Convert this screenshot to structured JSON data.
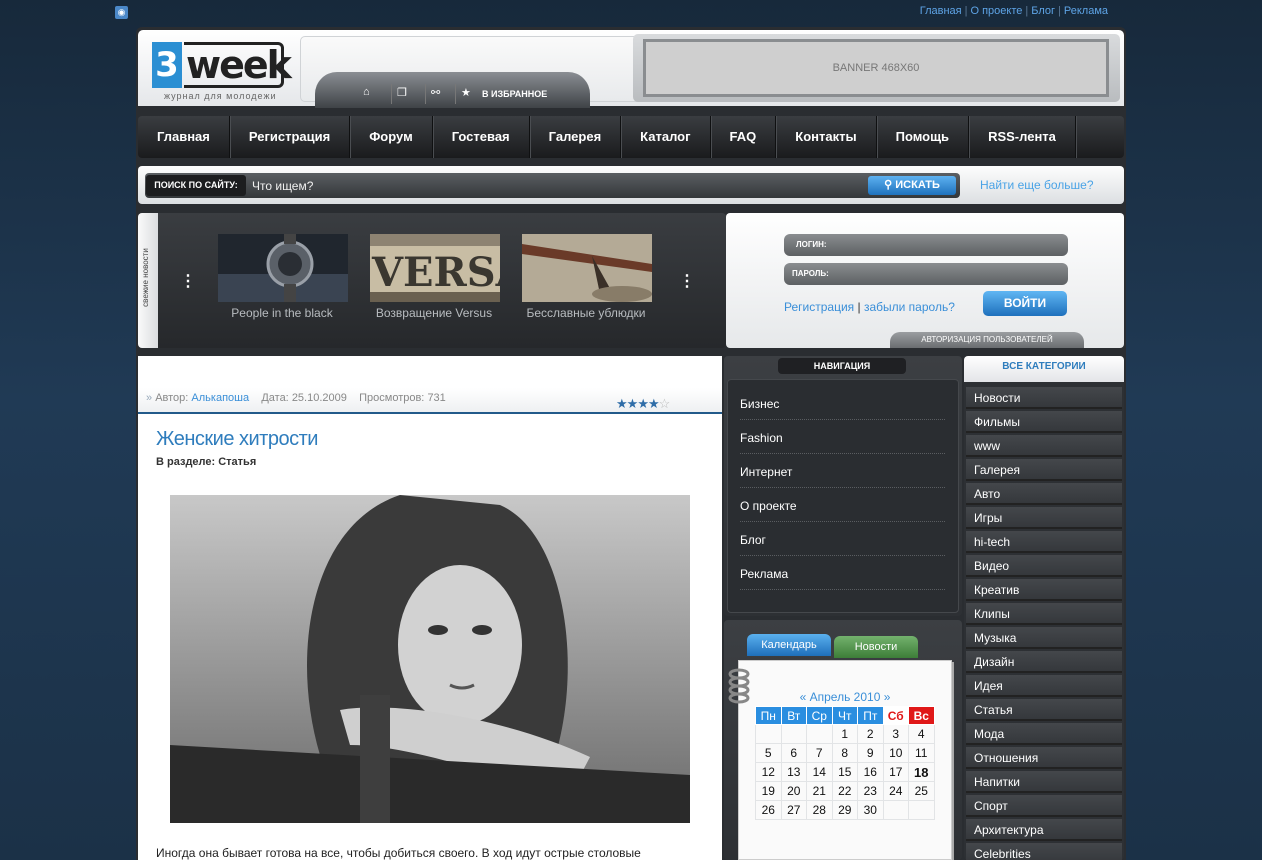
{
  "toplinks": [
    "Главная",
    "О проекте",
    "Блог",
    "Реклама"
  ],
  "logo": {
    "num": "3",
    "word": "week",
    "tagline": "журнал для молодежи"
  },
  "banner": "BANNER 468X60",
  "quickbar": {
    "favorites": "В ИЗБРАННОЕ"
  },
  "menu": [
    "Главная",
    "Регистрация",
    "Форум",
    "Гостевая",
    "Галерея",
    "Каталог",
    "FAQ",
    "Контакты",
    "Помощь",
    "RSS-лента"
  ],
  "search": {
    "label": "ПОИСК ПО САЙТУ:",
    "placeholder": "Что ищем?",
    "button": "ИСКАТЬ",
    "more": "Найти еще больше?"
  },
  "slider": {
    "side_label": "свежие новости",
    "items": [
      {
        "caption": "People in the black"
      },
      {
        "caption": "Возвращение Versus"
      },
      {
        "caption": "Бесславные ублюдки"
      }
    ]
  },
  "login": {
    "login_label": "ЛОГИН:",
    "password_label": "ПАРОЛЬ:",
    "register": "Регистрация",
    "forgot": "забыли пароль?",
    "button": "ВОЙТИ",
    "tab": "АВТОРИЗАЦИЯ ПОЛЬЗОВАТЕЛЕЙ"
  },
  "article": {
    "author_label": "Автор:",
    "author": "Алькапоша",
    "date_label": "Дата:",
    "date": "25.10.2009",
    "views_label": "Просмотров:",
    "views": "731",
    "rating": 4,
    "rating_max": 5,
    "title": "Женские хитрости",
    "section": "В разделе: Статья",
    "text": "Иногда она бывает готова на все, чтобы добиться своего. В ход идут острые столовые"
  },
  "nav": {
    "title": "НАВИГАЦИЯ",
    "items": [
      "Бизнес",
      "Fashion",
      "Интернет",
      "О проекте",
      "Блог",
      "Реклама"
    ]
  },
  "calendar": {
    "tab_calendar": "Календарь",
    "tab_news": "Новости",
    "nav": "«  Апрель 2010  »",
    "days": [
      "Пн",
      "Вт",
      "Ср",
      "Чт",
      "Пт",
      "Сб",
      "Вс"
    ],
    "weeks": [
      [
        "",
        "",
        "",
        "1",
        "2",
        "3",
        "4"
      ],
      [
        "5",
        "6",
        "7",
        "8",
        "9",
        "10",
        "11"
      ],
      [
        "12",
        "13",
        "14",
        "15",
        "16",
        "17",
        "18"
      ],
      [
        "19",
        "20",
        "21",
        "22",
        "23",
        "24",
        "25"
      ],
      [
        "26",
        "27",
        "28",
        "29",
        "30",
        "",
        ""
      ]
    ],
    "today": "18"
  },
  "categories": {
    "title": "ВСЕ КАТЕГОРИИ",
    "items": [
      "Новости",
      "Фильмы",
      "www",
      "Галерея",
      "Авто",
      "Игры",
      "hi-tech",
      "Видео",
      "Креатив",
      "Клипы",
      "Музыка",
      "Дизайн",
      "Идея",
      "Статья",
      "Мода",
      "Отношения",
      "Напитки",
      "Спорт",
      "Архитектура",
      "Celebrities"
    ]
  },
  "colors": {
    "accent": "#2f7dbd",
    "link": "#3a8fd8",
    "weekend": "#e01818",
    "dark": "#2a2d31"
  }
}
